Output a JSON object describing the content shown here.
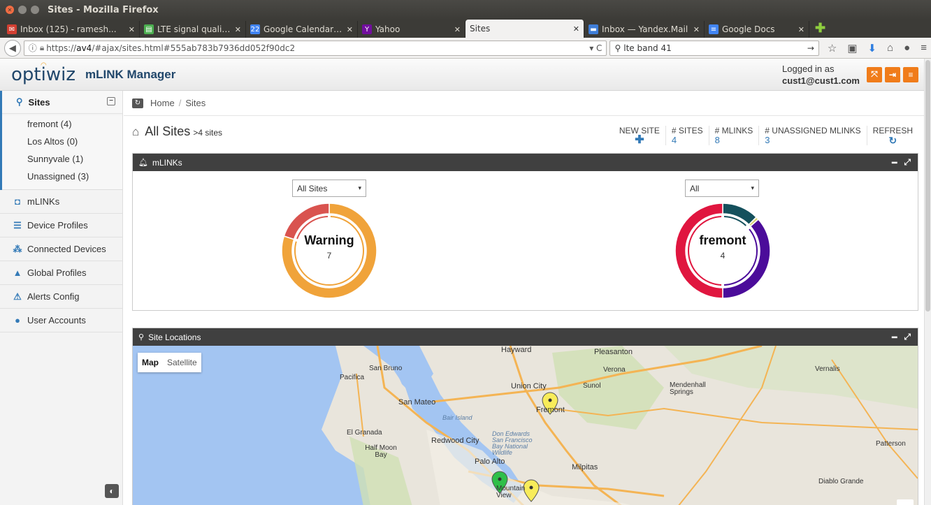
{
  "window": {
    "title": "Sites - Mozilla Firefox"
  },
  "tabs": [
    {
      "label": "Inbox (125) - ramesh...",
      "icon": "gmail-icon",
      "color": "#d23f31"
    },
    {
      "label": "LTE signal quality, w...",
      "icon": "doc-icon",
      "color": "#4caf50"
    },
    {
      "label": "Google Calendar - S...",
      "icon": "calendar-icon",
      "color": "#4285f4",
      "icon_text": "22"
    },
    {
      "label": "Yahoo",
      "icon": "yahoo-icon",
      "color": "#720e9e",
      "icon_text": "Y"
    },
    {
      "label": "Sites",
      "icon": "",
      "color": ""
    },
    {
      "label": "Inbox — Yandex.Mail",
      "icon": "mail-icon",
      "color": "#3f7ed8"
    },
    {
      "label": "Google Docs",
      "icon": "docs-icon",
      "color": "#4285f4"
    }
  ],
  "navbar": {
    "url_prefix": "https://",
    "url_host": "av4",
    "url_path": "/#ajax/sites.html#555ab783b7936dd052f90dc2",
    "search_value": "lte band 41",
    "reload_glyph": "▾ C"
  },
  "header": {
    "logo_text": "optiwiz",
    "brand": "mLINK Manager",
    "logged_in_label": "Logged in as",
    "user": "cust1@cust1.com"
  },
  "sidebar": {
    "sites_label": "Sites",
    "sites": [
      "fremont (4)",
      "Los Altos (0)",
      "Sunnyvale (1)",
      "Unassigned (3)"
    ],
    "menu": [
      {
        "label": "mLINKs",
        "icon": "router-icon"
      },
      {
        "label": "Device Profiles",
        "icon": "list-icon"
      },
      {
        "label": "Connected Devices",
        "icon": "sitemap-icon"
      },
      {
        "label": "Global Profiles",
        "icon": "lock-icon"
      },
      {
        "label": "Alerts Config",
        "icon": "warning-icon"
      },
      {
        "label": "User Accounts",
        "icon": "user-icon"
      }
    ]
  },
  "breadcrumb": {
    "home": "Home",
    "current": "Sites"
  },
  "page": {
    "title": "All Sites",
    "subtitle": ">4 sites",
    "stats": {
      "new_site": "NEW SITE",
      "sites_label": "# SITES",
      "sites_value": "4",
      "mlinks_label": "# MLINKS",
      "mlinks_value": "8",
      "unassigned_label": "# UNASSIGNED MLINKS",
      "unassigned_value": "3",
      "refresh_label": "REFRESH"
    }
  },
  "mlinks_widget": {
    "title": "mLINKs",
    "left_select": "All Sites",
    "right_select": "All",
    "left_donut": {
      "label": "Warning",
      "value": "7",
      "segments": [
        {
          "fraction": 0.8,
          "color": "#f0a33a"
        },
        {
          "fraction": 0.2,
          "color": "#d9534f"
        }
      ]
    },
    "right_donut": {
      "label": "fremont",
      "value": "4",
      "segments": [
        {
          "fraction": 0.125,
          "color": "#14505c"
        },
        {
          "fraction": 0.01,
          "color": "#d8d27a"
        },
        {
          "fraction": 0.365,
          "color": "#4b0c9a"
        },
        {
          "fraction": 0.5,
          "color": "#e0163f"
        }
      ]
    }
  },
  "map_widget": {
    "title": "Site Locations",
    "toggle_map": "Map",
    "toggle_satellite": "Satellite",
    "places": [
      "Hayward",
      "Pleasanton",
      "San Bruno",
      "Pacifica",
      "Union City",
      "Sunol",
      "Verona",
      "Mendenhall Springs",
      "San Mateo",
      "Fremont",
      "Bair Island",
      "El Granada",
      "Redwood City",
      "Half Moon Bay",
      "Don Edwards San Francisco Bay National Wildlife",
      "Palo Alto",
      "Milpitas",
      "Mountain View",
      "Vernalis",
      "Patterson",
      "Diablo Grande"
    ]
  },
  "colors": {
    "accent": "#337ab7",
    "header_button": "#f07c1a",
    "widget_header": "#404040"
  }
}
